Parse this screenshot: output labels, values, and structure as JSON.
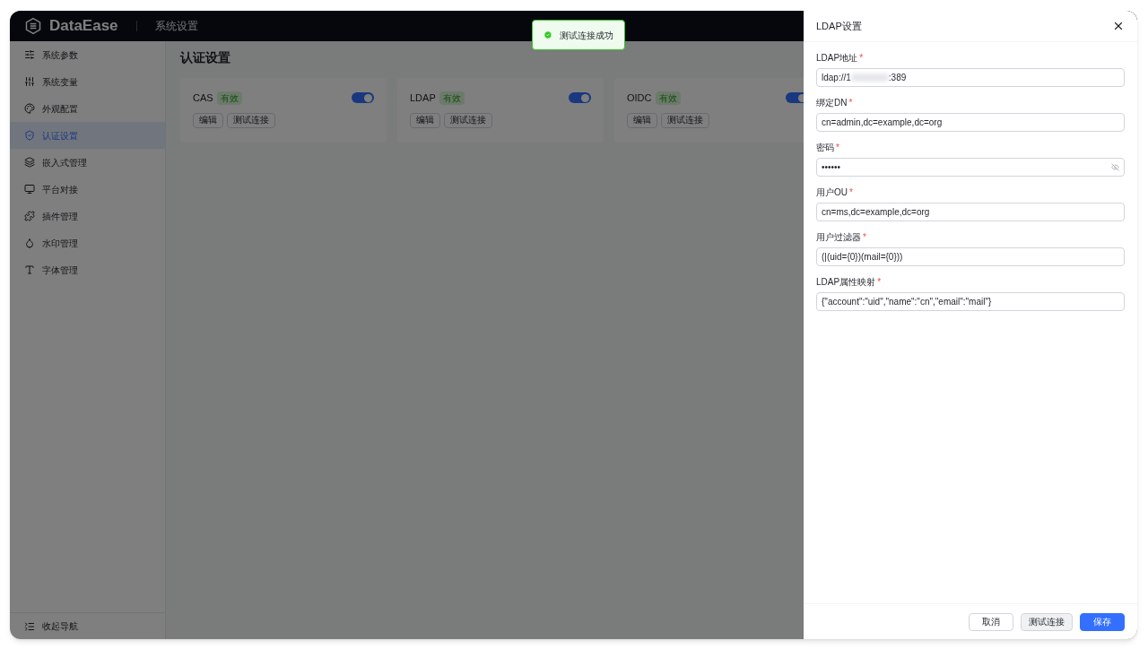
{
  "header": {
    "logo": "DataEase",
    "title": "系统设置"
  },
  "sidebar": {
    "items": [
      {
        "label": "系统参数",
        "selected": false
      },
      {
        "label": "系统变量",
        "selected": false
      },
      {
        "label": "外观配置",
        "selected": false
      },
      {
        "label": "认证设置",
        "selected": true
      },
      {
        "label": "嵌入式管理",
        "selected": false
      },
      {
        "label": "平台对接",
        "selected": false
      },
      {
        "label": "插件管理",
        "selected": false
      },
      {
        "label": "水印管理",
        "selected": false
      },
      {
        "label": "字体管理",
        "selected": false
      }
    ],
    "collapse": "收起导航"
  },
  "page_title": "认证设置",
  "cards": [
    {
      "name": "CAS",
      "status": "有效",
      "on": true,
      "buttons": [
        "编辑",
        "测试连接"
      ]
    },
    {
      "name": "LDAP",
      "status": "有效",
      "on": true,
      "buttons": [
        "编辑",
        "测试连接"
      ]
    },
    {
      "name": "OIDC",
      "status": "有效",
      "on": true,
      "buttons": [
        "编辑",
        "测试连接"
      ]
    }
  ],
  "toast": {
    "text": "测试连接成功"
  },
  "drawer": {
    "title": "LDAP设置",
    "fields": [
      {
        "label": "LDAP地址",
        "mark": "*",
        "kind": "redacted",
        "value": "ldap://1",
        "value_end": ":389"
      },
      {
        "label": "绑定DN",
        "mark": "*",
        "kind": "text",
        "value": "cn=admin,dc=example,dc=org"
      },
      {
        "label": "密码",
        "mark": "*",
        "kind": "password",
        "value": "••••••"
      },
      {
        "label": "用户OU",
        "mark": "*",
        "kind": "text",
        "value": "cn=ms,dc=example,dc=org"
      },
      {
        "label": "用户过滤器",
        "mark": "*",
        "kind": "text",
        "value": "(|(uid={0})(mail={0}))"
      },
      {
        "label": "LDAP属性映射",
        "mark": "*",
        "kind": "text",
        "value": "{\"account\":\"uid\",\"name\":\"cn\",\"email\":\"mail\"}"
      }
    ],
    "buttons": [
      {
        "label": "取消",
        "kind": "default"
      },
      {
        "label": "测试连接",
        "kind": "secondary"
      },
      {
        "label": "保存",
        "kind": "primary"
      }
    ]
  }
}
